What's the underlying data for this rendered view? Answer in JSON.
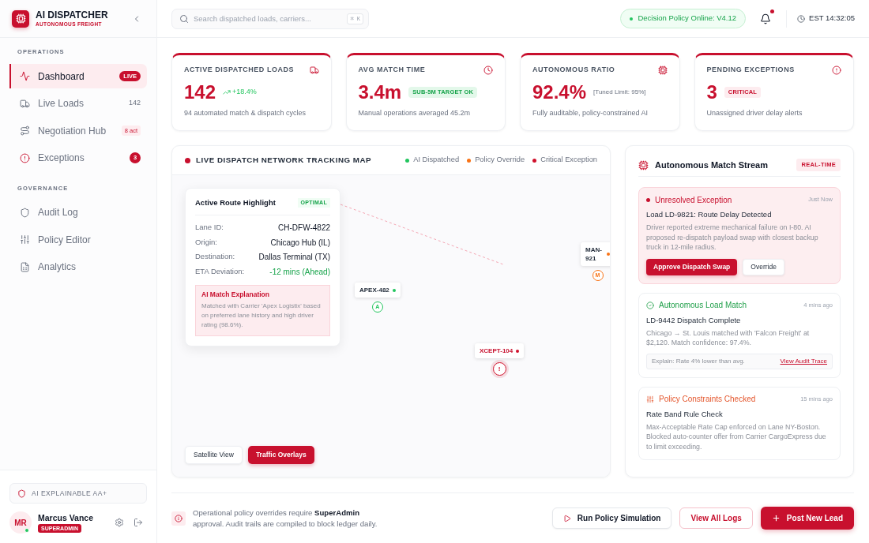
{
  "sidebar": {
    "brand": {
      "title": "AI DISPATCHER",
      "subtitle": "AUTONOMOUS FREIGHT"
    },
    "sections": [
      {
        "heading": "OPERATIONS",
        "items": [
          {
            "label": "Dashboard",
            "selected": true,
            "badge": {
              "kind": "live",
              "text": "LIVE"
            }
          },
          {
            "label": "Live Loads",
            "selected": false,
            "badge": {
              "kind": "count",
              "text": "142"
            }
          },
          {
            "label": "Negotiation Hub",
            "selected": false,
            "badge": {
              "kind": "tag",
              "text": "8 act"
            }
          },
          {
            "label": "Exceptions",
            "selected": false,
            "badge": {
              "kind": "alert",
              "text": "3"
            }
          }
        ]
      },
      {
        "heading": "GOVERNANCE",
        "items": [
          {
            "label": "Audit Log",
            "selected": false
          },
          {
            "label": "Policy Editor",
            "selected": false
          },
          {
            "label": "Analytics",
            "selected": false
          }
        ]
      }
    ],
    "compliance": "AI EXPLAINABLE AA+",
    "user": {
      "initials": "MR",
      "name": "Marcus Vance",
      "role": "SUPERADMIN",
      "online": true
    }
  },
  "topbar": {
    "search": {
      "placeholder": "Search dispatched loads, carriers...",
      "shortcut": "⌘ K"
    },
    "status": {
      "text": "Decision Policy Online: V4.12",
      "online": true
    },
    "notifications": {
      "unread": true
    },
    "clock": "EST 14:32:05"
  },
  "stats": [
    {
      "label": "ACTIVE DISPATCHED LOADS",
      "value": "142",
      "extra": {
        "kind": "trend",
        "text": "+18.4%"
      },
      "caption": "94 automated match & dispatch cycles"
    },
    {
      "label": "AVG MATCH TIME",
      "value": "3.4m",
      "extra": {
        "kind": "success",
        "text": "SUB-5M TARGET OK"
      },
      "caption": "Manual operations averaged 45.2m"
    },
    {
      "label": "AUTONOMOUS RATIO",
      "value": "92.4%",
      "extra": {
        "kind": "note",
        "text": "[Tuned Limit: 95%]"
      },
      "caption": "Fully auditable, policy-constrained AI"
    },
    {
      "label": "PENDING EXCEPTIONS",
      "value": "3",
      "extra": {
        "kind": "critical",
        "text": "CRITICAL"
      },
      "caption": "Unassigned driver delay alerts"
    }
  ],
  "map": {
    "title": "LIVE DISPATCH NETWORK TRACKING MAP",
    "legend": [
      {
        "label": "AI Dispatched",
        "color": "#22c55e"
      },
      {
        "label": "Policy Override",
        "color": "#f97316"
      },
      {
        "label": "Critical Exception",
        "color": "#d0102b"
      }
    ],
    "route_card": {
      "title": "Active Route Highlight",
      "status": "OPTIMAL",
      "fields": [
        {
          "label": "Lane ID:",
          "value": "CH-DFW-4822",
          "kind": "plain"
        },
        {
          "label": "Origin:",
          "value": "Chicago Hub (IL)",
          "kind": "plain"
        },
        {
          "label": "Destination:",
          "value": "Dallas Terminal (TX)",
          "kind": "plain"
        },
        {
          "label": "ETA Deviation:",
          "value": "-12 mins (Ahead)",
          "kind": "positive"
        }
      ],
      "explanation": {
        "title": "AI Match Explanation",
        "text": "Matched with Carrier 'Apex Logistix' based on preferred lane history and high driver rating (98.6%)."
      }
    },
    "markers": [
      {
        "label": "APEX-482",
        "glyph": "A",
        "color": "#22c55e",
        "kind": "normal"
      },
      {
        "label": "MAN-921",
        "glyph": "M",
        "color": "#f97316",
        "kind": "normal"
      },
      {
        "label": "XCEPT-104",
        "glyph": "!",
        "color": "#d0102b",
        "kind": "critical"
      }
    ],
    "view_buttons": [
      {
        "label": "Satellite View",
        "selected": false
      },
      {
        "label": "Traffic Overlays",
        "selected": true
      }
    ]
  },
  "stream": {
    "title": "Autonomous Match Stream",
    "badge": "REAL-TIME",
    "items": [
      {
        "kind": "exception",
        "title": "Unresolved Exception",
        "time": "Just Now",
        "heading": "Load LD-9821: Route Delay Detected",
        "text": "Driver reported extreme mechanical failure on I-80. AI proposed re-dispatch payload swap with closest backup truck in 12-mile radius.",
        "actions": [
          {
            "label": "Approve Dispatch Swap",
            "kind": "primary"
          },
          {
            "label": "Override",
            "kind": "secondary"
          }
        ]
      },
      {
        "kind": "match",
        "title": "Autonomous Load Match",
        "time": "4 mins ago",
        "heading": "LD-9442 Dispatch Complete",
        "text": "Chicago → St. Louis matched with 'Falcon Freight' at $2,120. Match confidence: 97.4%.",
        "explain": {
          "text": "Explain: Rate 4% lower than avg.",
          "link": "View Audit Trace"
        }
      },
      {
        "kind": "policy",
        "title": "Policy Constraints Checked",
        "time": "15 mins ago",
        "heading": "Rate Band Rule Check",
        "text": "Max-Acceptable Rate Cap enforced on Lane NY-Boston. Blocked auto-counter offer from Carrier CargoExpress due to limit exceeding."
      }
    ]
  },
  "footer": {
    "notice": "Operational policy overrides require **SuperAdmin** approval. Audit trails are compiled to block ledger daily.",
    "buttons": [
      {
        "label": "Run Policy Simulation",
        "kind": "outline"
      },
      {
        "label": "View All Logs",
        "kind": "accent"
      },
      {
        "label": "Post New Lead",
        "kind": "primary"
      }
    ]
  }
}
